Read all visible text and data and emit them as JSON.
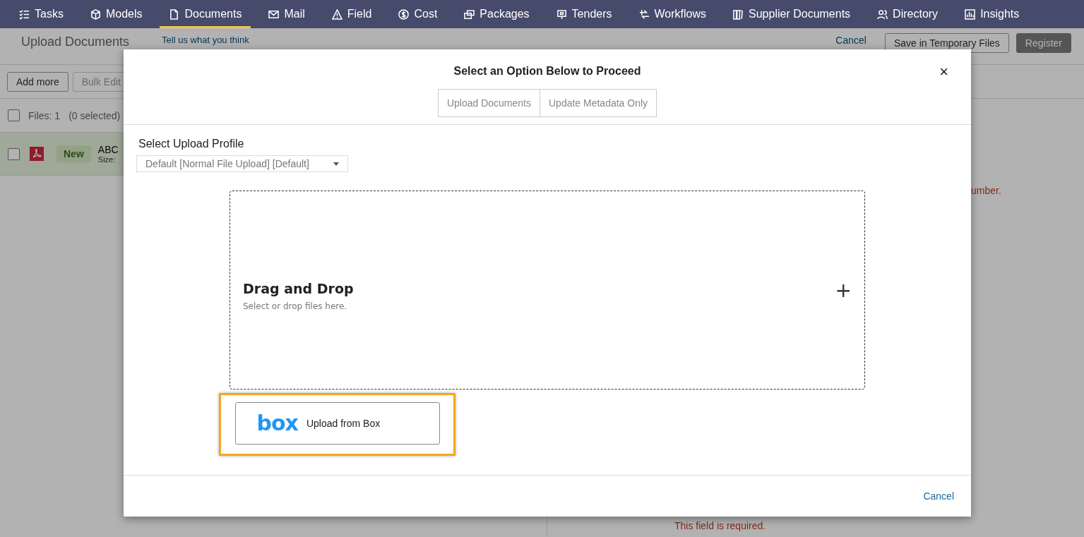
{
  "nav": [
    {
      "label": "Tasks",
      "selected": false
    },
    {
      "label": "Models",
      "selected": false
    },
    {
      "label": "Documents",
      "selected": true
    },
    {
      "label": "Mail",
      "selected": false
    },
    {
      "label": "Field",
      "selected": false
    },
    {
      "label": "Cost",
      "selected": false
    },
    {
      "label": "Packages",
      "selected": false
    },
    {
      "label": "Tenders",
      "selected": false
    },
    {
      "label": "Workflows",
      "selected": false
    },
    {
      "label": "Supplier Documents",
      "selected": false
    },
    {
      "label": "Directory",
      "selected": false
    },
    {
      "label": "Insights",
      "selected": false
    }
  ],
  "page": {
    "title": "Upload Documents",
    "feedback_link": "Tell us what you think",
    "cancel": "Cancel",
    "save_button": "Save in Temporary Files",
    "register_button": "Register",
    "register_disabled": true,
    "toolbar": [
      "Add more",
      "Bulk Edit"
    ],
    "files_count": "Files: 1",
    "selected_count": "(0 selected)",
    "select_all_checked": false,
    "file": {
      "checked": false,
      "status": "New",
      "name": "ABC",
      "size": "Size:"
    },
    "errors": [
      "umber.",
      "This field is required."
    ]
  },
  "modal": {
    "title": "Select an Option Below to Proceed",
    "close": "×",
    "tabs": [
      {
        "label": "Upload Documents",
        "selected": false
      },
      {
        "label": "Update Metadata Only",
        "selected": false
      }
    ],
    "profile_label": "Select Upload Profile",
    "profile_value": "Default [Normal File Upload] [Default]",
    "dropzone": {
      "title": "Drag and Drop",
      "hint": "Select or drop files here.",
      "plus": "+"
    },
    "box_button": {
      "logo": "box",
      "label": "Upload from Box",
      "highlighted": true
    },
    "footer_cancel": "Cancel"
  }
}
